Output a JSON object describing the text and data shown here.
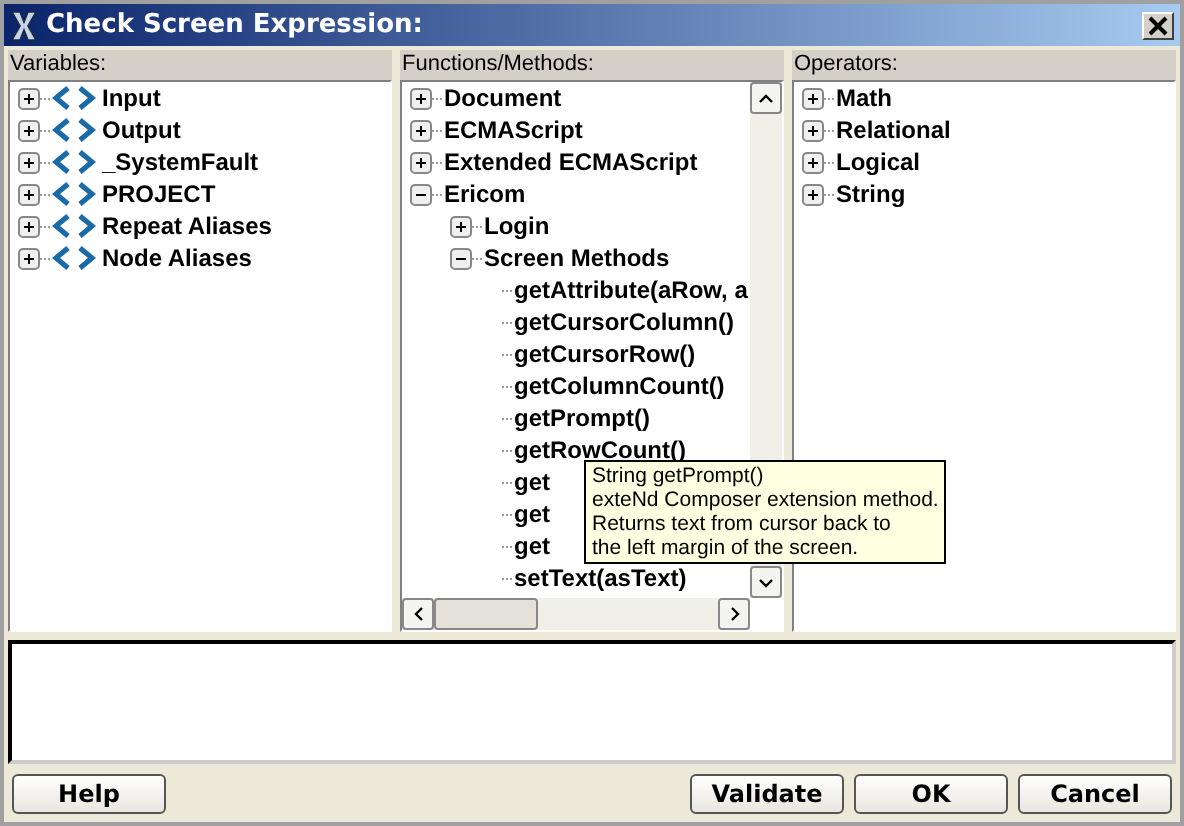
{
  "window": {
    "title": "Check Screen Expression:"
  },
  "variables": {
    "label": "Variables:",
    "items": [
      {
        "text": "Input",
        "expanded": false
      },
      {
        "text": "Output",
        "expanded": false
      },
      {
        "text": "_SystemFault",
        "expanded": false
      },
      {
        "text": "PROJECT",
        "expanded": false
      },
      {
        "text": "Repeat Aliases",
        "expanded": false
      },
      {
        "text": "Node Aliases",
        "expanded": false
      }
    ]
  },
  "functions": {
    "label": "Functions/Methods:",
    "items": [
      {
        "text": "Document",
        "expanded": false
      },
      {
        "text": "ECMAScript",
        "expanded": false
      },
      {
        "text": "Extended ECMAScript",
        "expanded": false
      },
      {
        "text": "Ericom",
        "expanded": true,
        "children": [
          {
            "text": "Login",
            "expanded": false
          },
          {
            "text": "Screen Methods",
            "expanded": true,
            "children": [
              {
                "text": "getAttribute(aRow, a"
              },
              {
                "text": "getCursorColumn()"
              },
              {
                "text": "getCursorRow()"
              },
              {
                "text": "getColumnCount()"
              },
              {
                "text": "getPrompt()"
              },
              {
                "text": "getRowCount()"
              },
              {
                "text": "get"
              },
              {
                "text": "get"
              },
              {
                "text": "get"
              },
              {
                "text": "setText(asText)"
              }
            ]
          }
        ]
      }
    ]
  },
  "tooltip": {
    "lines": [
      "String getPrompt()",
      "exteNd Composer extension method.",
      "Returns text from cursor back to",
      "the left margin of the screen."
    ]
  },
  "operators": {
    "label": "Operators:",
    "items": [
      {
        "text": "Math",
        "expanded": false
      },
      {
        "text": "Relational",
        "expanded": false
      },
      {
        "text": "Logical",
        "expanded": false
      },
      {
        "text": "String",
        "expanded": false
      }
    ]
  },
  "buttons_left": [
    "Help"
  ],
  "buttons_right": [
    "Validate",
    "OK",
    "Cancel"
  ]
}
